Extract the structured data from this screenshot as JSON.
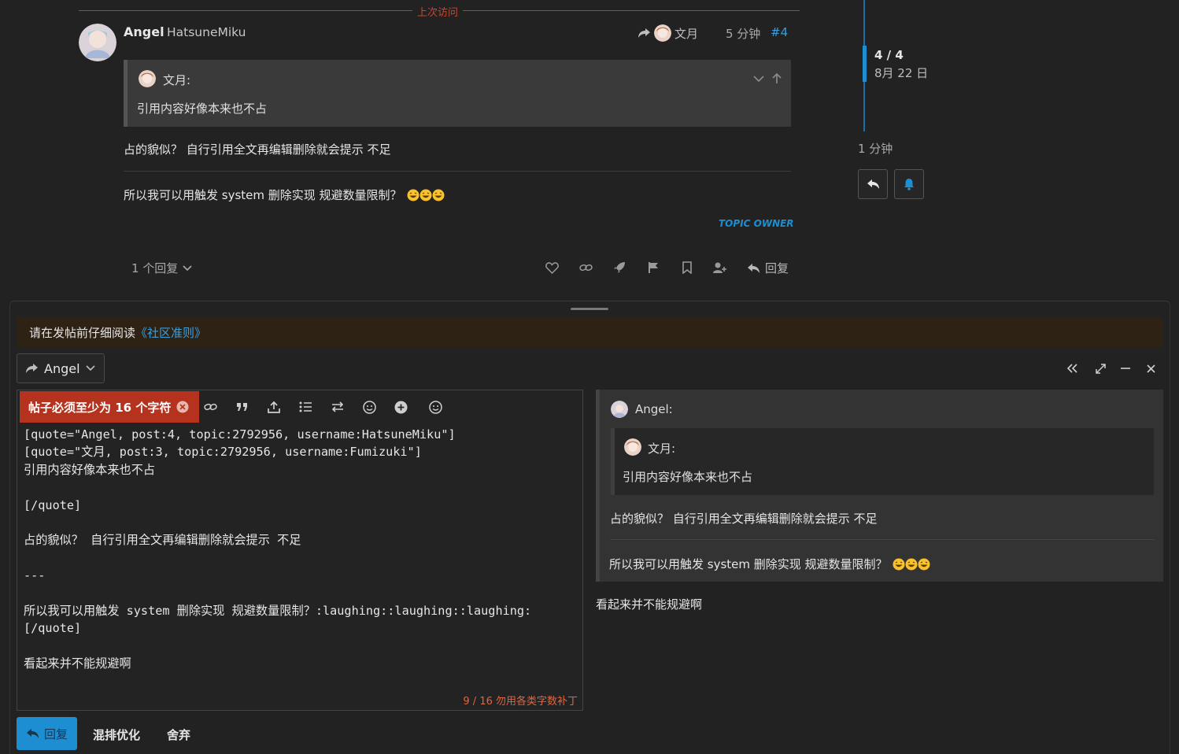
{
  "last_visit": {
    "label": "上次访问"
  },
  "post": {
    "display_name": "Angel",
    "username": "HatsuneMiku",
    "reply_to_name": "文月",
    "time": "5 分钟",
    "post_number": "#4",
    "quote": {
      "author": "文月:",
      "text": "引用内容好像本来也不占"
    },
    "paragraph1": "占的貌似？ 自行引用全文再编辑删除就会提示 不足",
    "paragraph2": "所以我可以用触发 system 删除实现 规避数量限制？",
    "emoji": [
      "laughing",
      "laughing",
      "laughing"
    ],
    "owner_badge": "TOPIC OWNER",
    "replies_label": "1 个回复",
    "reply_label": "回复"
  },
  "timeline": {
    "progress": "4 / 4",
    "date": "8月 22 日",
    "position_fraction": 1.0,
    "last_time": "1 分钟"
  },
  "composer": {
    "notice_prefix": "请在发帖前仔细阅读",
    "notice_link": "《社区准则》",
    "reply_as": "Angel",
    "error_chip": "帖子必须至少为 16 个字符",
    "editor_lines": [
      "[quote=\"Angel, post:4, topic:2792956, username:HatsuneMiku\"]",
      "[quote=\"文月, post:3, topic:2792956, username:Fumizuki\"]",
      "引用内容好像本来也不占",
      "",
      "[/quote]",
      "",
      "占的貌似？ 自行引用全文再编辑删除就会提示 不足",
      "",
      "---",
      "",
      "所以我可以用触发 system 删除实现 规避数量限制？:laughing::laughing::laughing:",
      "[/quote]",
      "",
      "看起来并不能规避啊"
    ],
    "char_counter": "9 / 16 勿用各类字数补丁",
    "preview": {
      "author": "Angel:",
      "inner_author": "文月:",
      "inner_text": "引用内容好像本来也不占",
      "paragraph1": "占的貌似？ 自行引用全文再编辑删除就会提示 不足",
      "paragraph2": "所以我可以用触发 system 删除实现 规避数量限制？",
      "after": "看起来并不能规避啊"
    },
    "submit_label": "回复",
    "typeset_label": "混排优化",
    "discard_label": "舍弃"
  },
  "colors": {
    "accent": "#1c8ed1",
    "link": "#3a9fe0",
    "error": "#b5321f",
    "counter": "#e0663f",
    "last_visit": "#c8472f"
  }
}
